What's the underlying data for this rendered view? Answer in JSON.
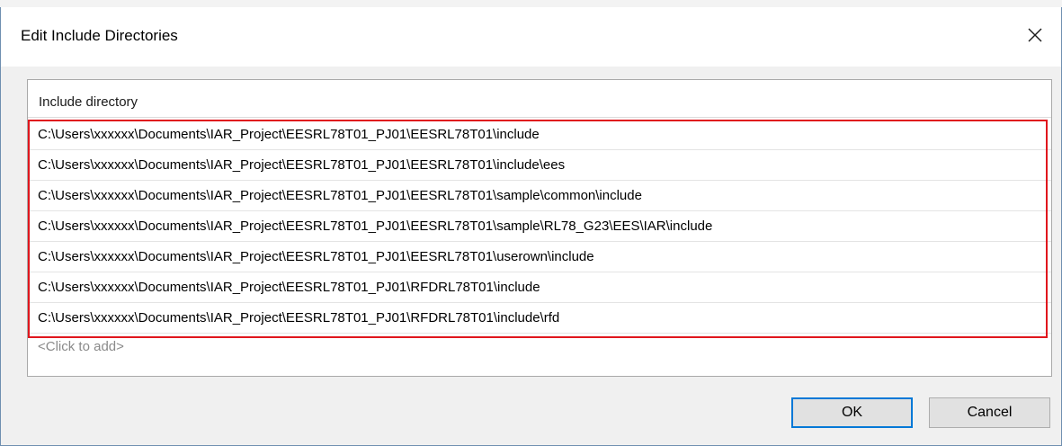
{
  "dialog": {
    "title": "Edit Include Directories",
    "close_icon": "close-icon"
  },
  "list": {
    "header": "Include directory",
    "items": [
      "C:\\Users\\xxxxxx\\Documents\\IAR_Project\\EESRL78T01_PJ01\\EESRL78T01\\include",
      "C:\\Users\\xxxxxx\\Documents\\IAR_Project\\EESRL78T01_PJ01\\EESRL78T01\\include\\ees",
      "C:\\Users\\xxxxxx\\Documents\\IAR_Project\\EESRL78T01_PJ01\\EESRL78T01\\sample\\common\\include",
      "C:\\Users\\xxxxxx\\Documents\\IAR_Project\\EESRL78T01_PJ01\\EESRL78T01\\sample\\RL78_G23\\EES\\IAR\\include",
      "C:\\Users\\xxxxxx\\Documents\\IAR_Project\\EESRL78T01_PJ01\\EESRL78T01\\userown\\include",
      "C:\\Users\\xxxxxx\\Documents\\IAR_Project\\EESRL78T01_PJ01\\RFDRL78T01\\include",
      "C:\\Users\\xxxxxx\\Documents\\IAR_Project\\EESRL78T01_PJ01\\RFDRL78T01\\include\\rfd"
    ],
    "add_placeholder": "<Click to add>",
    "highlight_color": "#e0161d"
  },
  "buttons": {
    "ok": "OK",
    "cancel": "Cancel"
  },
  "colors": {
    "dialog_bg": "#f0f0f0",
    "accent": "#0078d7"
  }
}
